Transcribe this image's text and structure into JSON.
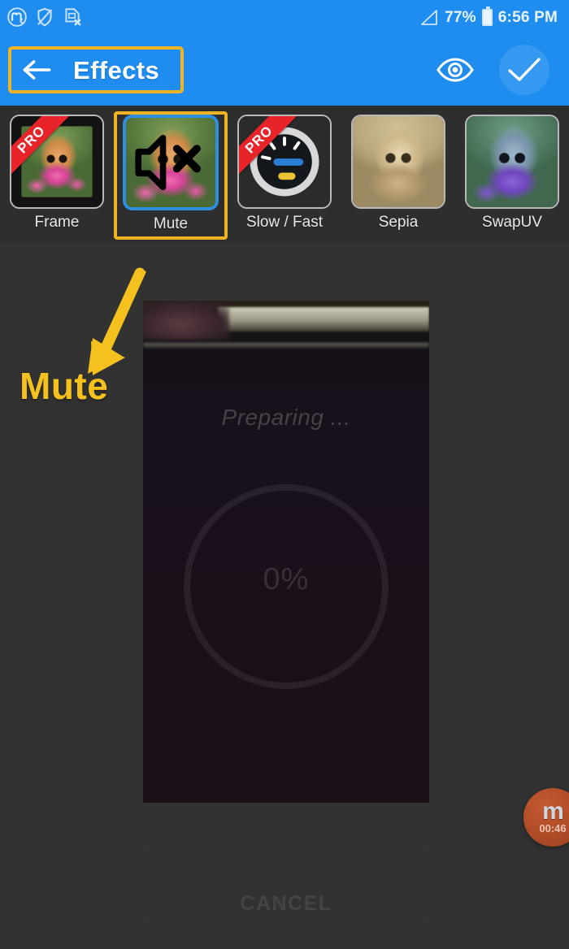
{
  "status_bar": {
    "icons": [
      {
        "name": "app-notification-icon",
        "glyph": "m-circle"
      },
      {
        "name": "shield-off-icon",
        "glyph": "shield-slash"
      },
      {
        "name": "sim-card-missing-icon",
        "glyph": "doc-x"
      }
    ],
    "signal_label": "signal-triangle-icon",
    "battery_percent": "77%",
    "battery_icon": "battery-icon",
    "time": "6:56 PM"
  },
  "app_bar": {
    "back_label": "back-arrow-icon",
    "title": "Effects",
    "preview_icon": "eye-icon",
    "confirm_icon": "check-icon"
  },
  "effects": {
    "items": [
      {
        "label": "Frame",
        "pro": true,
        "selected": false,
        "badge": "PRO",
        "thumb": "frame"
      },
      {
        "label": "Mute",
        "pro": false,
        "selected": true,
        "badge": "",
        "thumb": "mute"
      },
      {
        "label": "Slow / Fast",
        "pro": true,
        "selected": false,
        "badge": "PRO",
        "thumb": "speed"
      },
      {
        "label": "Sepia",
        "pro": false,
        "selected": false,
        "badge": "",
        "thumb": "sepia"
      },
      {
        "label": "SwapUV",
        "pro": false,
        "selected": false,
        "badge": "",
        "thumb": "swapuv"
      }
    ]
  },
  "annotation": {
    "label": "Mute",
    "color": "#f5c11e",
    "arrow_name": "annotation-arrow"
  },
  "preview": {
    "status_text": "Preparing ...",
    "progress_percent": "0%",
    "cancel_label": "CANCEL"
  },
  "floating_widget": {
    "logo": "m",
    "timer": "00:46"
  },
  "colors": {
    "accent_blue": "#1f8df0",
    "highlight_yellow": "#f0b323",
    "pro_red": "#e8232a",
    "selection_blue": "#2e8fe0",
    "background": "#323232"
  }
}
